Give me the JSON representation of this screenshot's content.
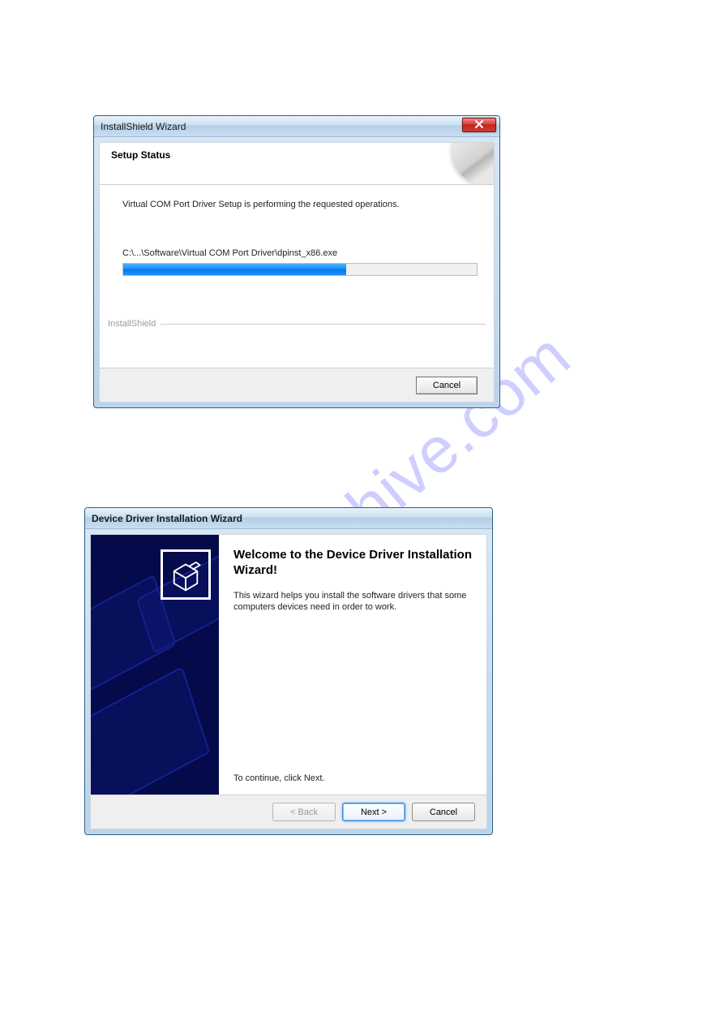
{
  "watermark": "manualshive.com",
  "window1": {
    "title": "InstallShield Wizard",
    "header_title": "Setup Status",
    "status_text": "Virtual COM Port Driver Setup is performing the requested operations.",
    "path_text": "C:\\...\\Software\\Virtual COM Port Driver\\dpinst_x86.exe",
    "progress_percent": 63,
    "brand_label": "InstallShield",
    "cancel_label": "Cancel"
  },
  "window2": {
    "title": "Device Driver Installation Wizard",
    "heading": "Welcome to the Device Driver Installation Wizard!",
    "description": "This wizard helps you install the software drivers that some computers devices need in order to work.",
    "continue_text": "To continue, click Next.",
    "back_label": "< Back",
    "next_label": "Next >",
    "cancel_label": "Cancel"
  }
}
